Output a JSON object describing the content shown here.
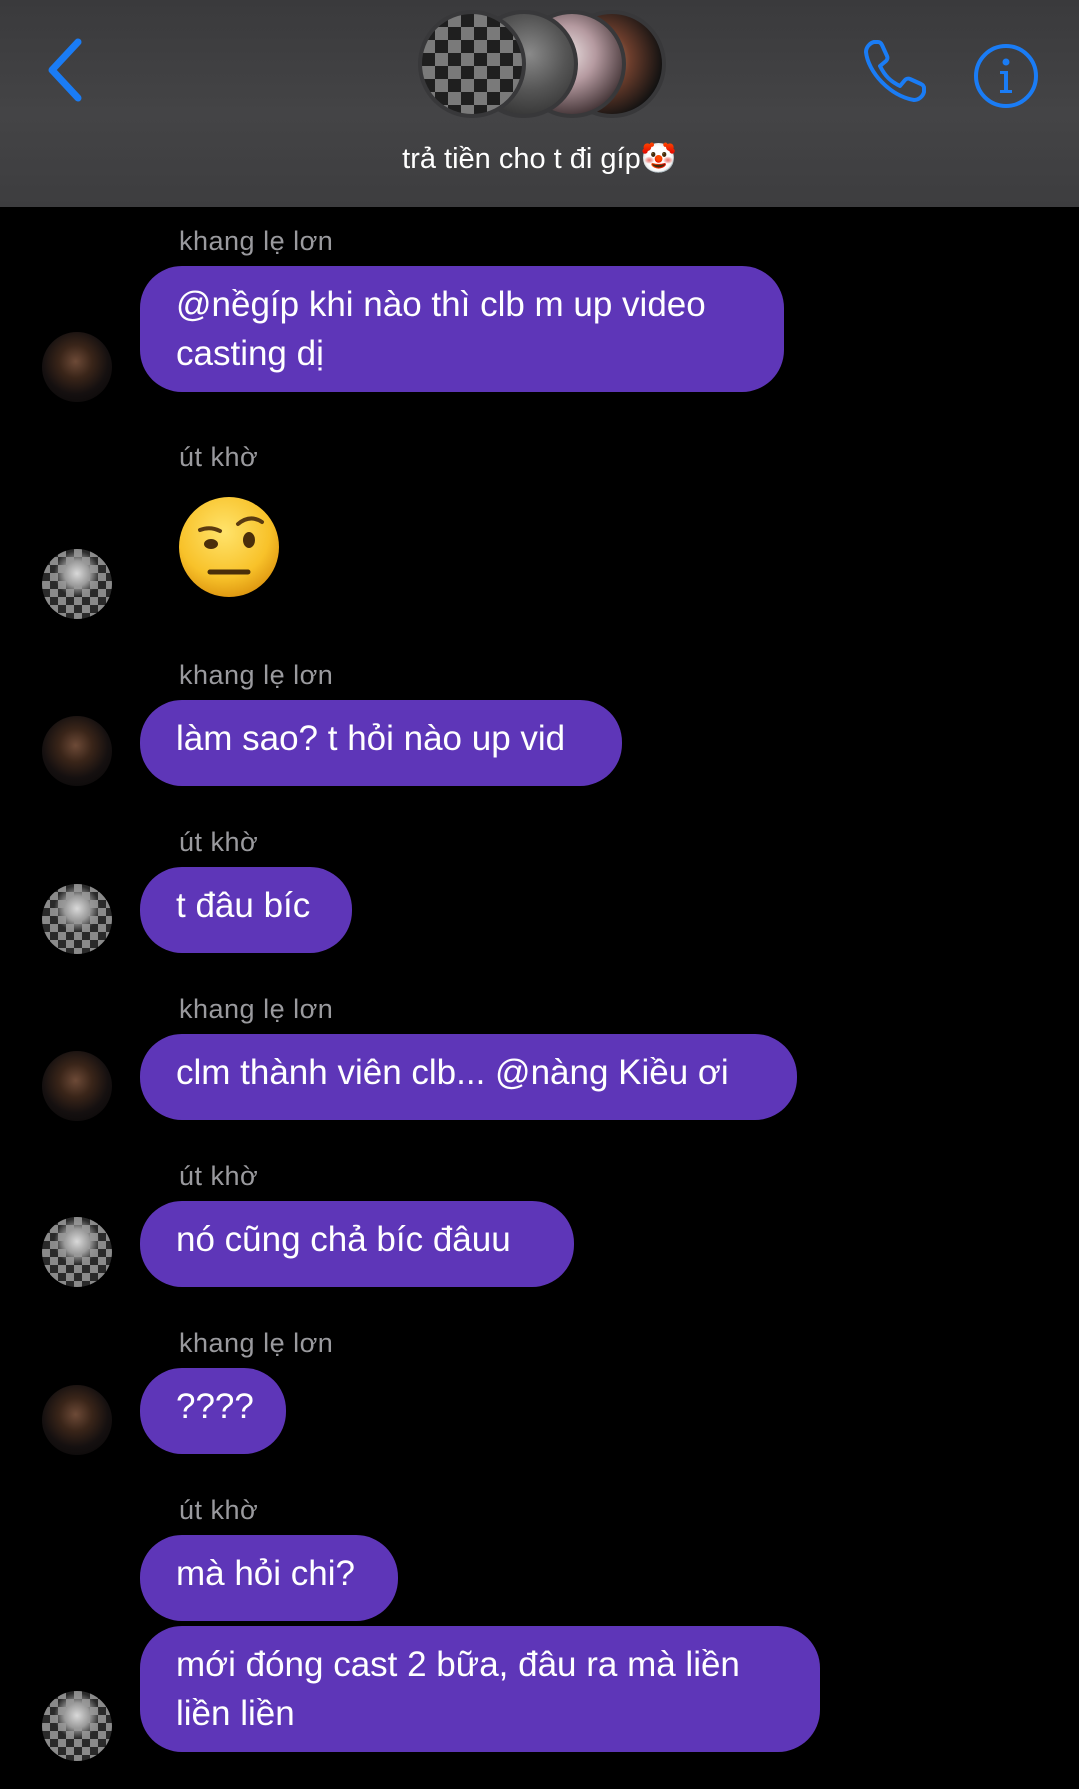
{
  "header": {
    "group_name": "trả tiền cho t đi gíp🤡",
    "icons": [
      "chevron-left-icon",
      "phone-icon",
      "info-icon"
    ],
    "accent_color": "#1a7cf5"
  },
  "colors": {
    "bubble": "#5e36b8",
    "background": "#000000",
    "sender_name": "#9a9a9e"
  },
  "messages": [
    {
      "sender": "khang lẹ lơn",
      "lines": [
        "@nềgíp khi nào thì clb m up video",
        "casting dị"
      ]
    },
    {
      "sender": "út khờ",
      "emoji": "face-with-raised-eyebrow-icon"
    },
    {
      "sender": "khang lẹ lơn",
      "lines": [
        "làm sao? t hỏi nào up vid"
      ]
    },
    {
      "sender": "út khờ",
      "lines": [
        "t đâu bíc"
      ]
    },
    {
      "sender": "khang lẹ lơn",
      "lines": [
        "clm thành viên clb... @nàng Kiều ơi"
      ]
    },
    {
      "sender": "út khờ",
      "lines": [
        "nó cũng chả bíc đâuu"
      ]
    },
    {
      "sender": "khang lẹ lơn",
      "lines": [
        "????"
      ]
    },
    {
      "sender": "út khờ",
      "lines": [
        "mà hỏi chi?"
      ]
    },
    {
      "sender": "út khờ",
      "lines": [
        "mới đóng cast 2 bữa, đâu ra mà liền",
        "liền liền"
      ]
    }
  ]
}
